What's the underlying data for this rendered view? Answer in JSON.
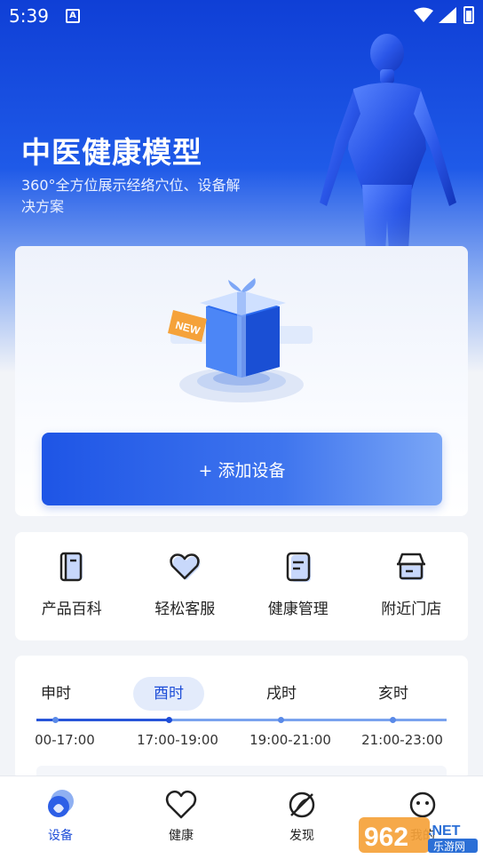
{
  "status_bar": {
    "time": "5:39",
    "notif_letter": "A"
  },
  "hero": {
    "title": "中医健康模型",
    "subtitle": "360°全方位展示经络穴位、设备解决方案"
  },
  "device_card": {
    "badge": "NEW",
    "add_button_label": "+ 添加设备"
  },
  "quick_actions": [
    {
      "label": "产品百科",
      "icon": "book-icon"
    },
    {
      "label": "轻松客服",
      "icon": "heart-icon"
    },
    {
      "label": "健康管理",
      "icon": "clipboard-icon"
    },
    {
      "label": "附近门店",
      "icon": "store-icon"
    }
  ],
  "time_periods": [
    {
      "name": "申时",
      "range": "00-17:00"
    },
    {
      "name": "酉时",
      "range": "17:00-19:00",
      "active": true
    },
    {
      "name": "戌时",
      "range": "19:00-21:00"
    },
    {
      "name": "亥时",
      "range": "21:00-23:00"
    }
  ],
  "tabbar": [
    {
      "label": "设备",
      "icon": "device-icon",
      "active": true
    },
    {
      "label": "健康",
      "icon": "heart-icon"
    },
    {
      "label": "发现",
      "icon": "compass-icon"
    },
    {
      "label": "我的",
      "icon": "face-icon"
    }
  ],
  "watermark": {
    "number": "962",
    "suffix": ".NET",
    "site": "乐游网"
  },
  "colors": {
    "primary": "#1f4fd8",
    "hero_top": "#0f3fd6",
    "accent_orange": "#f5a23a"
  }
}
